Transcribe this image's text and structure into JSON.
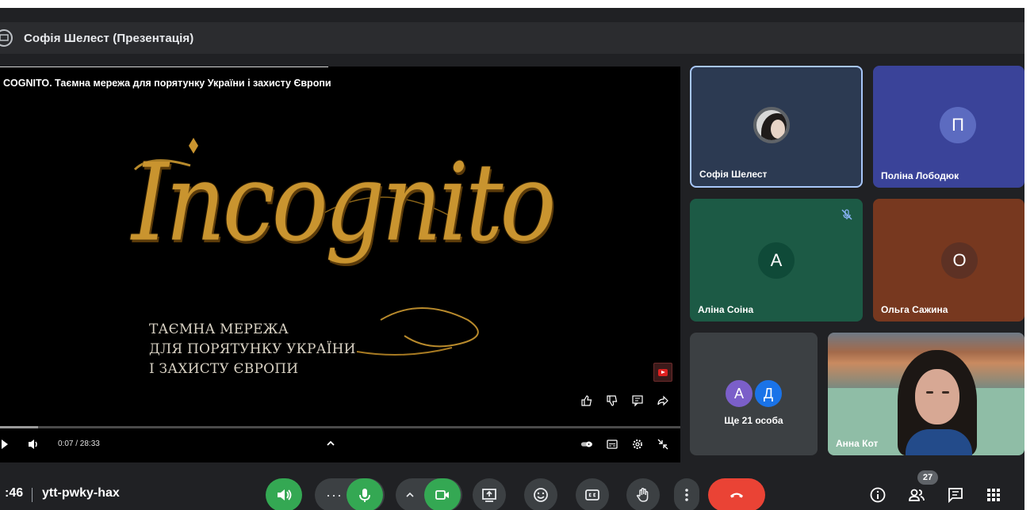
{
  "topbar": {
    "presenter": "Софія Шелест (Презентація)"
  },
  "presentation": {
    "video_title": "COGNITO. Таємна мережа для порятунку України і захисту Європи",
    "logo_word": "Incognito",
    "tagline": [
      "ТАЄМНА МЕРЕЖА",
      "ДЛЯ ПОРЯТУНКУ УКРАЇНИ",
      "І ЗАХИСТУ ЄВРОПИ"
    ],
    "time": "0:07 / 28:33",
    "progress_fraction": 0.004
  },
  "participants": [
    {
      "name": "Софія Шелест",
      "avatar": "photo"
    },
    {
      "name": "Поліна Лободюк",
      "avatar": "П",
      "color": "#5c6bc0"
    },
    {
      "name": "Аліна Соіна",
      "avatar": "А",
      "color": "#0f4a38",
      "muted": true
    },
    {
      "name": "Ольга Сажина",
      "avatar": "О",
      "color": "#5d3124"
    },
    {
      "more_label": "Ще 21 особа",
      "avatars": [
        "А",
        "Д"
      ],
      "colors": [
        "#7b5fc9",
        "#1a73e8"
      ]
    },
    {
      "name": "Анна Кот"
    }
  ],
  "bottom": {
    "time": ":46",
    "meeting_code": "ytt-pwky-hax",
    "participant_count": "27",
    "colors": {
      "green": "#34a853",
      "red": "#ea4335",
      "button": "#3c4043"
    }
  },
  "icons": [
    "presentation-icon",
    "youtube-icon",
    "thumb-up-icon",
    "thumb-down-icon",
    "comment-icon",
    "share-icon",
    "play-icon",
    "volume-icon",
    "chevron-up-icon",
    "autoplay-icon",
    "subtitles-icon",
    "settings-icon",
    "exit-fullscreen-icon",
    "mic-off-icon",
    "speaker-icon",
    "more-icon",
    "mic-icon",
    "camera-icon",
    "present-icon",
    "emoji-icon",
    "captions-icon",
    "raise-hand-icon",
    "hang-up-icon",
    "info-icon",
    "people-icon",
    "chat-icon",
    "activities-icon"
  ]
}
